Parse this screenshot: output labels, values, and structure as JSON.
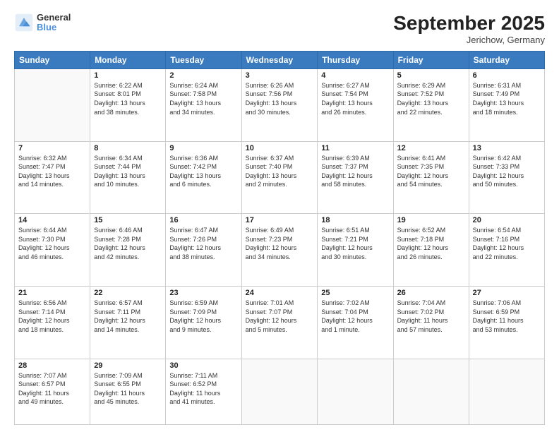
{
  "header": {
    "logo_line1": "General",
    "logo_line2": "Blue",
    "title": "September 2025",
    "subtitle": "Jerichow, Germany"
  },
  "days_of_week": [
    "Sunday",
    "Monday",
    "Tuesday",
    "Wednesday",
    "Thursday",
    "Friday",
    "Saturday"
  ],
  "weeks": [
    [
      {
        "day": "",
        "info": ""
      },
      {
        "day": "1",
        "info": "Sunrise: 6:22 AM\nSunset: 8:01 PM\nDaylight: 13 hours\nand 38 minutes."
      },
      {
        "day": "2",
        "info": "Sunrise: 6:24 AM\nSunset: 7:58 PM\nDaylight: 13 hours\nand 34 minutes."
      },
      {
        "day": "3",
        "info": "Sunrise: 6:26 AM\nSunset: 7:56 PM\nDaylight: 13 hours\nand 30 minutes."
      },
      {
        "day": "4",
        "info": "Sunrise: 6:27 AM\nSunset: 7:54 PM\nDaylight: 13 hours\nand 26 minutes."
      },
      {
        "day": "5",
        "info": "Sunrise: 6:29 AM\nSunset: 7:52 PM\nDaylight: 13 hours\nand 22 minutes."
      },
      {
        "day": "6",
        "info": "Sunrise: 6:31 AM\nSunset: 7:49 PM\nDaylight: 13 hours\nand 18 minutes."
      }
    ],
    [
      {
        "day": "7",
        "info": "Sunrise: 6:32 AM\nSunset: 7:47 PM\nDaylight: 13 hours\nand 14 minutes."
      },
      {
        "day": "8",
        "info": "Sunrise: 6:34 AM\nSunset: 7:44 PM\nDaylight: 13 hours\nand 10 minutes."
      },
      {
        "day": "9",
        "info": "Sunrise: 6:36 AM\nSunset: 7:42 PM\nDaylight: 13 hours\nand 6 minutes."
      },
      {
        "day": "10",
        "info": "Sunrise: 6:37 AM\nSunset: 7:40 PM\nDaylight: 13 hours\nand 2 minutes."
      },
      {
        "day": "11",
        "info": "Sunrise: 6:39 AM\nSunset: 7:37 PM\nDaylight: 12 hours\nand 58 minutes."
      },
      {
        "day": "12",
        "info": "Sunrise: 6:41 AM\nSunset: 7:35 PM\nDaylight: 12 hours\nand 54 minutes."
      },
      {
        "day": "13",
        "info": "Sunrise: 6:42 AM\nSunset: 7:33 PM\nDaylight: 12 hours\nand 50 minutes."
      }
    ],
    [
      {
        "day": "14",
        "info": "Sunrise: 6:44 AM\nSunset: 7:30 PM\nDaylight: 12 hours\nand 46 minutes."
      },
      {
        "day": "15",
        "info": "Sunrise: 6:46 AM\nSunset: 7:28 PM\nDaylight: 12 hours\nand 42 minutes."
      },
      {
        "day": "16",
        "info": "Sunrise: 6:47 AM\nSunset: 7:26 PM\nDaylight: 12 hours\nand 38 minutes."
      },
      {
        "day": "17",
        "info": "Sunrise: 6:49 AM\nSunset: 7:23 PM\nDaylight: 12 hours\nand 34 minutes."
      },
      {
        "day": "18",
        "info": "Sunrise: 6:51 AM\nSunset: 7:21 PM\nDaylight: 12 hours\nand 30 minutes."
      },
      {
        "day": "19",
        "info": "Sunrise: 6:52 AM\nSunset: 7:18 PM\nDaylight: 12 hours\nand 26 minutes."
      },
      {
        "day": "20",
        "info": "Sunrise: 6:54 AM\nSunset: 7:16 PM\nDaylight: 12 hours\nand 22 minutes."
      }
    ],
    [
      {
        "day": "21",
        "info": "Sunrise: 6:56 AM\nSunset: 7:14 PM\nDaylight: 12 hours\nand 18 minutes."
      },
      {
        "day": "22",
        "info": "Sunrise: 6:57 AM\nSunset: 7:11 PM\nDaylight: 12 hours\nand 14 minutes."
      },
      {
        "day": "23",
        "info": "Sunrise: 6:59 AM\nSunset: 7:09 PM\nDaylight: 12 hours\nand 9 minutes."
      },
      {
        "day": "24",
        "info": "Sunrise: 7:01 AM\nSunset: 7:07 PM\nDaylight: 12 hours\nand 5 minutes."
      },
      {
        "day": "25",
        "info": "Sunrise: 7:02 AM\nSunset: 7:04 PM\nDaylight: 12 hours\nand 1 minute."
      },
      {
        "day": "26",
        "info": "Sunrise: 7:04 AM\nSunset: 7:02 PM\nDaylight: 11 hours\nand 57 minutes."
      },
      {
        "day": "27",
        "info": "Sunrise: 7:06 AM\nSunset: 6:59 PM\nDaylight: 11 hours\nand 53 minutes."
      }
    ],
    [
      {
        "day": "28",
        "info": "Sunrise: 7:07 AM\nSunset: 6:57 PM\nDaylight: 11 hours\nand 49 minutes."
      },
      {
        "day": "29",
        "info": "Sunrise: 7:09 AM\nSunset: 6:55 PM\nDaylight: 11 hours\nand 45 minutes."
      },
      {
        "day": "30",
        "info": "Sunrise: 7:11 AM\nSunset: 6:52 PM\nDaylight: 11 hours\nand 41 minutes."
      },
      {
        "day": "",
        "info": ""
      },
      {
        "day": "",
        "info": ""
      },
      {
        "day": "",
        "info": ""
      },
      {
        "day": "",
        "info": ""
      }
    ]
  ]
}
